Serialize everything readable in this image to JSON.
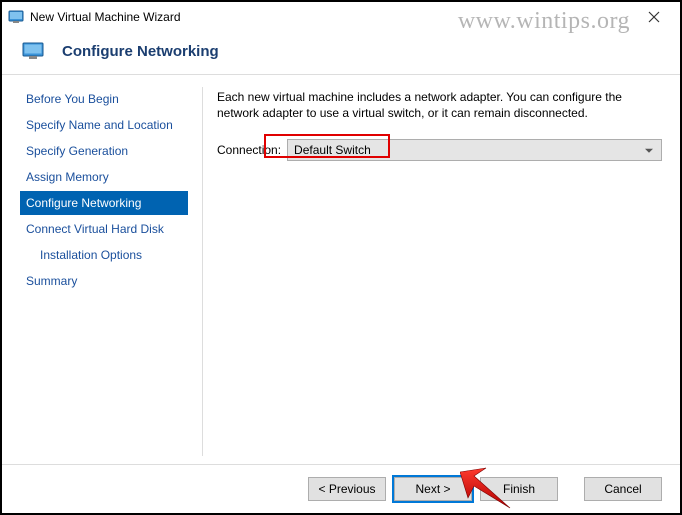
{
  "window": {
    "title": "New Virtual Machine Wizard"
  },
  "header": {
    "title": "Configure Networking"
  },
  "sidebar": {
    "steps": [
      {
        "label": "Before You Begin"
      },
      {
        "label": "Specify Name and Location"
      },
      {
        "label": "Specify Generation"
      },
      {
        "label": "Assign Memory"
      },
      {
        "label": "Configure Networking"
      },
      {
        "label": "Connect Virtual Hard Disk"
      },
      {
        "label": "Installation Options"
      },
      {
        "label": "Summary"
      }
    ],
    "active_index": 4
  },
  "main": {
    "description": "Each new virtual machine includes a network adapter. You can configure the network adapter to use a virtual switch, or it can remain disconnected.",
    "connection_label": "Connection:",
    "connection_value": "Default Switch"
  },
  "footer": {
    "previous": "< Previous",
    "next": "Next >",
    "finish": "Finish",
    "cancel": "Cancel"
  },
  "watermark": "www.wintips.org"
}
